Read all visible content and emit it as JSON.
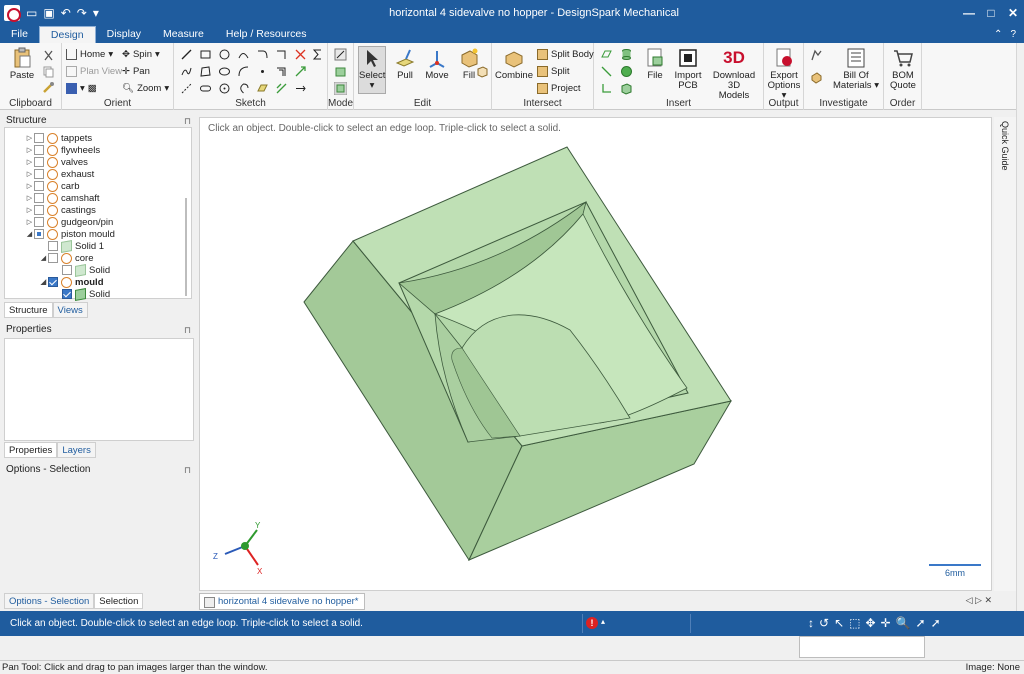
{
  "window": {
    "title": "horizontal 4 sidevalve no hopper - DesignSpark Mechanical",
    "controls": [
      "—",
      "□",
      "✕"
    ]
  },
  "menu": {
    "tabs": [
      {
        "label": "File",
        "active": false
      },
      {
        "label": "Design",
        "active": true
      },
      {
        "label": "Display",
        "active": false
      },
      {
        "label": "Measure",
        "active": false
      },
      {
        "label": "Help / Resources",
        "active": false
      }
    ],
    "right_controls": [
      "⌃",
      "?"
    ]
  },
  "ribbon": {
    "clipboard": {
      "label": "Clipboard",
      "paste": "Paste"
    },
    "orient": {
      "label": "Orient",
      "home": "Home",
      "spin": "Spin",
      "plan_view": "Plan View",
      "pan": "Pan",
      "zoom": "Zoom"
    },
    "sketch": {
      "label": "Sketch"
    },
    "mode": {
      "label": "Mode"
    },
    "edit": {
      "label": "Edit",
      "select": "Select",
      "pull": "Pull",
      "move": "Move",
      "fill": "Fill"
    },
    "intersect": {
      "label": "Intersect",
      "combine": "Combine",
      "split_body": "Split Body",
      "split": "Split",
      "project": "Project"
    },
    "insert": {
      "label": "Insert",
      "file": "File",
      "import_pcb_1": "Import",
      "import_pcb_2": "PCB",
      "download_1": "Download 3D",
      "download_2": "Models",
      "download_logo": "3D"
    },
    "output": {
      "label": "Output",
      "export_1": "Export",
      "export_2": "Options"
    },
    "investigate": {
      "label": "Investigate",
      "bom_1": "Bill Of",
      "bom_2": "Materials"
    },
    "order": {
      "label": "Order",
      "quote_1": "BOM",
      "quote_2": "Quote"
    }
  },
  "structure": {
    "title": "Structure",
    "items": [
      {
        "label": "tappets",
        "level": 0,
        "expand": "▷",
        "check": "none",
        "icon": "comp",
        "bold": false
      },
      {
        "label": "flywheels",
        "level": 0,
        "expand": "▷",
        "check": "none",
        "icon": "comp",
        "bold": false
      },
      {
        "label": "valves",
        "level": 0,
        "expand": "▷",
        "check": "none",
        "icon": "comp",
        "bold": false
      },
      {
        "label": "exhaust",
        "level": 0,
        "expand": "▷",
        "check": "none",
        "icon": "comp",
        "bold": false
      },
      {
        "label": "carb",
        "level": 0,
        "expand": "▷",
        "check": "none",
        "icon": "comp",
        "bold": false
      },
      {
        "label": "camshaft",
        "level": 0,
        "expand": "▷",
        "check": "none",
        "icon": "comp",
        "bold": false
      },
      {
        "label": "castings",
        "level": 0,
        "expand": "▷",
        "check": "none",
        "icon": "comp",
        "bold": false
      },
      {
        "label": "gudgeon/pin",
        "level": 0,
        "expand": "▷",
        "check": "none",
        "icon": "comp",
        "bold": false
      },
      {
        "label": "piston mould",
        "level": 0,
        "expand": "◢",
        "check": "partial",
        "icon": "comp",
        "bold": false
      },
      {
        "label": "Solid 1",
        "level": 1,
        "expand": "",
        "check": "none",
        "icon": "solid-faded",
        "bold": false
      },
      {
        "label": "core",
        "level": 1,
        "expand": "◢",
        "check": "none",
        "icon": "comp",
        "bold": false
      },
      {
        "label": "Solid",
        "level": 2,
        "expand": "",
        "check": "none",
        "icon": "solid-faded",
        "bold": false
      },
      {
        "label": "mould",
        "level": 1,
        "expand": "◢",
        "check": "checked",
        "icon": "comp",
        "bold": true
      },
      {
        "label": "Solid",
        "level": 2,
        "expand": "",
        "check": "checked",
        "icon": "solid",
        "bold": false
      }
    ],
    "tabs": [
      "Structure",
      "Views"
    ]
  },
  "properties": {
    "title": "Properties",
    "tabs": [
      "Properties",
      "Layers"
    ]
  },
  "options": {
    "title": "Options - Selection",
    "tabs": [
      "Options - Selection",
      "Selection"
    ]
  },
  "viewport": {
    "hint": "Click an object. Double-click to select an edge loop. Triple-click to select a solid.",
    "scale_label": "6mm",
    "axes": {
      "x": "X",
      "y": "Y",
      "z": "Z"
    },
    "side_tab": "Quick Guide"
  },
  "document_tab": {
    "label": "horizontal 4 sidevalve no hopper*",
    "nav": "◁ ▷ ✕"
  },
  "status": {
    "message": "Click an object. Double-click to select an edge loop. Triple-click to select a solid.",
    "error_badge": "!",
    "tools": [
      "↕",
      "↺",
      "↖",
      "⬚",
      "✥",
      "✛",
      "🔍",
      "➚",
      "➚"
    ]
  },
  "os_status": {
    "left": "Pan Tool: Click and drag to pan images larger than the window.",
    "right": "Image: None"
  },
  "colors": {
    "accent": "#1f5c9e",
    "model_face": "#b9ddb0",
    "model_edge": "#3d5a3d"
  }
}
